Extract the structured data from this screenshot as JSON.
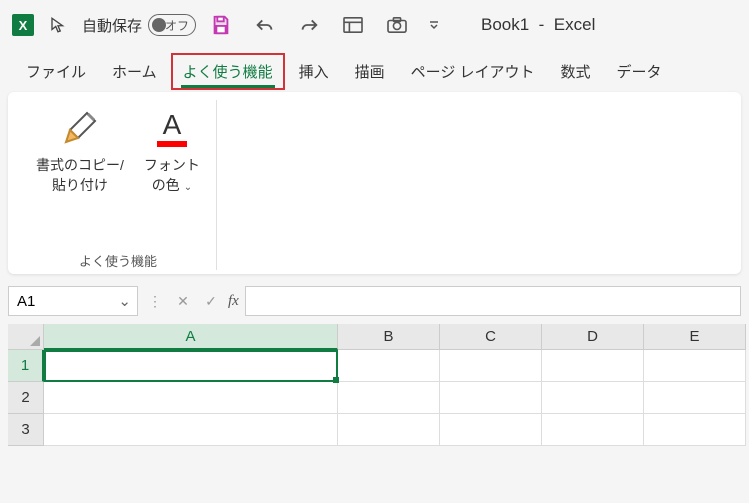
{
  "titlebar": {
    "autosave_label": "自動保存",
    "autosave_state": "オフ",
    "book_name": "Book1",
    "separator": "-",
    "app_name": "Excel"
  },
  "tabs": {
    "file": "ファイル",
    "home": "ホーム",
    "freq": "よく使う機能",
    "insert": "挿入",
    "draw": "描画",
    "page_layout": "ページ レイアウト",
    "formulas": "数式",
    "data": "データ"
  },
  "ribbon": {
    "format_painter": {
      "line1": "書式のコピー/",
      "line2": "貼り付け"
    },
    "font_color": {
      "line1": "フォント",
      "line2": "の色"
    },
    "group_label": "よく使う機能"
  },
  "formula_bar": {
    "namebox": "A1",
    "fx": "fx",
    "value": ""
  },
  "grid": {
    "cols": [
      "A",
      "B",
      "C",
      "D",
      "E"
    ],
    "rows": [
      "1",
      "2",
      "3"
    ]
  }
}
